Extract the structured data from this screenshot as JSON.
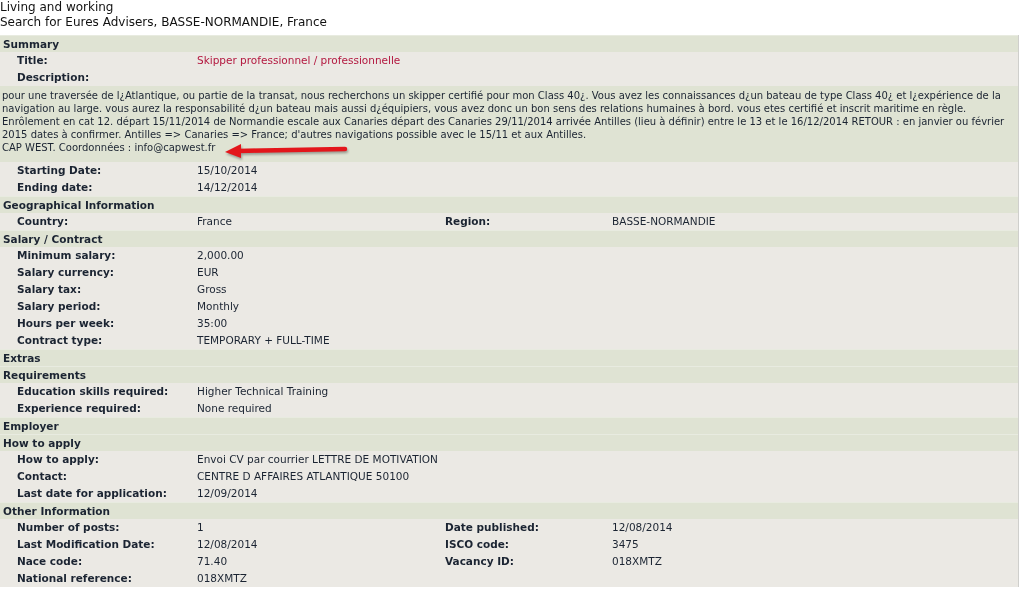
{
  "page": {
    "section": "Living and working",
    "heading": "Search for Eures Advisers, BASSE-NORMANDIE, France"
  },
  "sections": [
    {
      "title": "Summary",
      "rows": [
        {
          "kind": "title",
          "fields": [
            {
              "label": "Title:",
              "value": "Skipper professionnel / professionnelle"
            }
          ]
        },
        {
          "kind": "field",
          "fields": [
            {
              "label": "Description:"
            }
          ]
        },
        {
          "kind": "text",
          "paragraphs": [
            "pour une traversée de l¿Atlantique, ou partie de la transat, nous recherchons un skipper certifié pour mon Class 40¿. Vous avez les connaissances d¿un bateau de type Class 40¿ et l¿expérience de la navigation au large. vous aurez la responsabilité d¿un bateau mais aussi d¿équipiers, vous avez donc un bon sens des relations humaines à bord. vous etes certifié et inscrit maritime en règle. Enrôlement en cat 12. départ 15/11/2014 de Normandie escale aux Canaries départ des Canaries 29/11/2014 arrivée Antilles (lieu à définir) entre le 13 et le 16/12/2014 RETOUR : en janvier ou février 2015 dates à confirmer. Antilles => Canaries => France; d'autres navigations possible avec le 15/11 et aux Antilles.",
            "CAP WEST. Coordonnées : info@capwest.fr"
          ]
        },
        {
          "kind": "field",
          "fields": [
            {
              "label": "Starting Date:",
              "value": "15/10/2014"
            }
          ]
        },
        {
          "kind": "field",
          "fields": [
            {
              "label": "Ending date:",
              "value": "14/12/2014"
            }
          ]
        }
      ]
    },
    {
      "title": "Geographical Information",
      "rows": [
        {
          "kind": "field",
          "fields": [
            {
              "label": "Country:",
              "value": "France"
            },
            {
              "label": "Region:",
              "value": "BASSE-NORMANDIE"
            }
          ]
        }
      ]
    },
    {
      "title": "Salary / Contract",
      "rows": [
        {
          "kind": "field",
          "fields": [
            {
              "label": "Minimum salary:",
              "value": "2,000.00"
            }
          ]
        },
        {
          "kind": "field",
          "fields": [
            {
              "label": "Salary currency:",
              "value": "EUR"
            }
          ]
        },
        {
          "kind": "field",
          "fields": [
            {
              "label": "Salary tax:",
              "value": "Gross"
            }
          ]
        },
        {
          "kind": "field",
          "fields": [
            {
              "label": "Salary period:",
              "value": "Monthly"
            }
          ]
        },
        {
          "kind": "field",
          "fields": [
            {
              "label": "Hours per week:",
              "value": "35:00"
            }
          ]
        },
        {
          "kind": "field",
          "fields": [
            {
              "label": "Contract type:",
              "value": "TEMPORARY + FULL-TIME"
            }
          ]
        }
      ]
    },
    {
      "title": "Extras"
    },
    {
      "title": "Requirements",
      "rows": [
        {
          "kind": "field",
          "fields": [
            {
              "label": "Education skills required:",
              "value": "Higher Technical Training"
            }
          ]
        },
        {
          "kind": "field",
          "fields": [
            {
              "label": "Experience required:",
              "value": "None required"
            }
          ]
        }
      ]
    },
    {
      "title": "Employer"
    },
    {
      "title": "How to apply",
      "rows": [
        {
          "kind": "field",
          "fields": [
            {
              "label": "How to apply:",
              "value": "Envoi CV par courrier LETTRE DE MOTIVATION"
            }
          ]
        },
        {
          "kind": "field",
          "fields": [
            {
              "label": "Contact:",
              "value": "CENTRE D AFFAIRES ATLANTIQUE 50100"
            }
          ]
        },
        {
          "kind": "field",
          "fields": [
            {
              "label": "Last date for application:",
              "value": "12/09/2014"
            }
          ]
        }
      ]
    },
    {
      "title": "Other Information",
      "rows": [
        {
          "kind": "field",
          "fields": [
            {
              "label": "Number of posts:",
              "value": "1"
            },
            {
              "label": "Date published:",
              "value": "12/08/2014"
            }
          ]
        },
        {
          "kind": "field",
          "fields": [
            {
              "label": "Last Modification Date:",
              "value": "12/08/2014"
            },
            {
              "label": "ISCO code:",
              "value": "3475"
            }
          ]
        },
        {
          "kind": "field",
          "fields": [
            {
              "label": "Nace code:",
              "value": "71.40"
            },
            {
              "label": "Vacancy ID:",
              "value": "018XMTZ"
            }
          ]
        },
        {
          "kind": "field",
          "fields": [
            {
              "label": "National reference:",
              "value": "018XMTZ"
            }
          ]
        }
      ]
    }
  ]
}
